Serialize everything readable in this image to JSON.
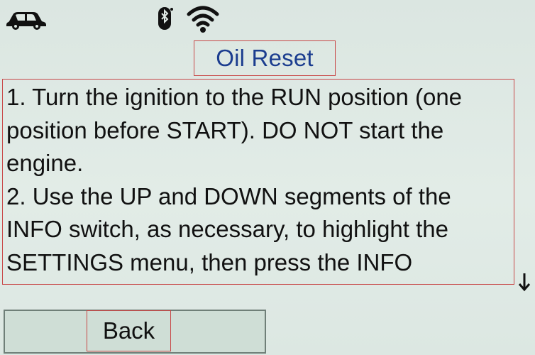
{
  "status_bar": {
    "car_icon": "car-icon",
    "bluetooth_icon": "bluetooth-icon",
    "wifi_icon": "wifi-icon"
  },
  "screen": {
    "title": "Oil Reset",
    "instructions": "1. Turn the ignition to the RUN position (one\nposition before START). DO NOT start the\nengine.\n2. Use the UP and DOWN segments of the\nINFO switch, as necessary, to highlight the\nSETTINGS menu, then press the INFO",
    "scroll_indicator": "↓"
  },
  "footer": {
    "back_label": "Back"
  },
  "colors": {
    "background": "#dfe9e4",
    "title": "#1b3d8f",
    "text": "#111111",
    "highlight_border": "#c84848"
  }
}
